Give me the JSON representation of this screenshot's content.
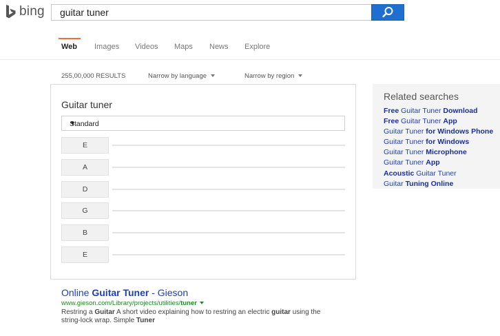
{
  "header": {
    "logo_text": "bing",
    "search_value": "guitar tuner"
  },
  "nav": {
    "tabs": [
      {
        "label": "Web",
        "active": true
      },
      {
        "label": "Images",
        "active": false
      },
      {
        "label": "Videos",
        "active": false
      },
      {
        "label": "Maps",
        "active": false
      },
      {
        "label": "News",
        "active": false
      },
      {
        "label": "Explore",
        "active": false
      }
    ]
  },
  "meta": {
    "results_count": "255,00,000 RESULTS",
    "narrow_language": "Narrow by language",
    "narrow_region": "Narrow by region"
  },
  "tuner": {
    "title": "Guitar tuner",
    "tuning_selected": "Standard",
    "strings": [
      "E",
      "A",
      "D",
      "G",
      "B",
      "E"
    ]
  },
  "result": {
    "title_pre": "Online ",
    "title_bold": "Guitar Tuner",
    "title_post": " - Gieson",
    "url_pre": "www.gieson.com/Library/projects/utilities/",
    "url_bold": "tuner",
    "snippet_parts": [
      {
        "text": "Restring a ",
        "bold": false
      },
      {
        "text": "Guitar",
        "bold": true
      },
      {
        "text": " A short video explaining how to restring an electric ",
        "bold": false
      },
      {
        "text": "guitar",
        "bold": true
      },
      {
        "text": " using the string-lock wrap. Simple ",
        "bold": false
      },
      {
        "text": "Tuner",
        "bold": true
      }
    ]
  },
  "related": {
    "title": "Related searches",
    "items": [
      [
        {
          "t": "Free",
          "b": true
        },
        {
          "t": " Guitar Tuner ",
          "b": false
        },
        {
          "t": "Download",
          "b": true
        }
      ],
      [
        {
          "t": "Free",
          "b": true
        },
        {
          "t": " Guitar Tuner ",
          "b": false
        },
        {
          "t": "App",
          "b": true
        }
      ],
      [
        {
          "t": "Guitar Tuner ",
          "b": false
        },
        {
          "t": "for Windows Phone",
          "b": true
        }
      ],
      [
        {
          "t": "Guitar Tuner ",
          "b": false
        },
        {
          "t": "for Windows",
          "b": true
        }
      ],
      [
        {
          "t": "Guitar Tuner ",
          "b": false
        },
        {
          "t": "Microphone",
          "b": true
        }
      ],
      [
        {
          "t": "Guitar Tuner ",
          "b": false
        },
        {
          "t": "App",
          "b": true
        }
      ],
      [
        {
          "t": "Acoustic",
          "b": true
        },
        {
          "t": " Guitar Tuner",
          "b": false
        }
      ],
      [
        {
          "t": "Guitar ",
          "b": false
        },
        {
          "t": "Tuning Online",
          "b": true
        }
      ]
    ]
  },
  "colors": {
    "accent": "#1e6fd0",
    "active_tab_underline": "#ec6f3c",
    "link": "#1e3fb3",
    "url_green": "#1e8a1e"
  }
}
